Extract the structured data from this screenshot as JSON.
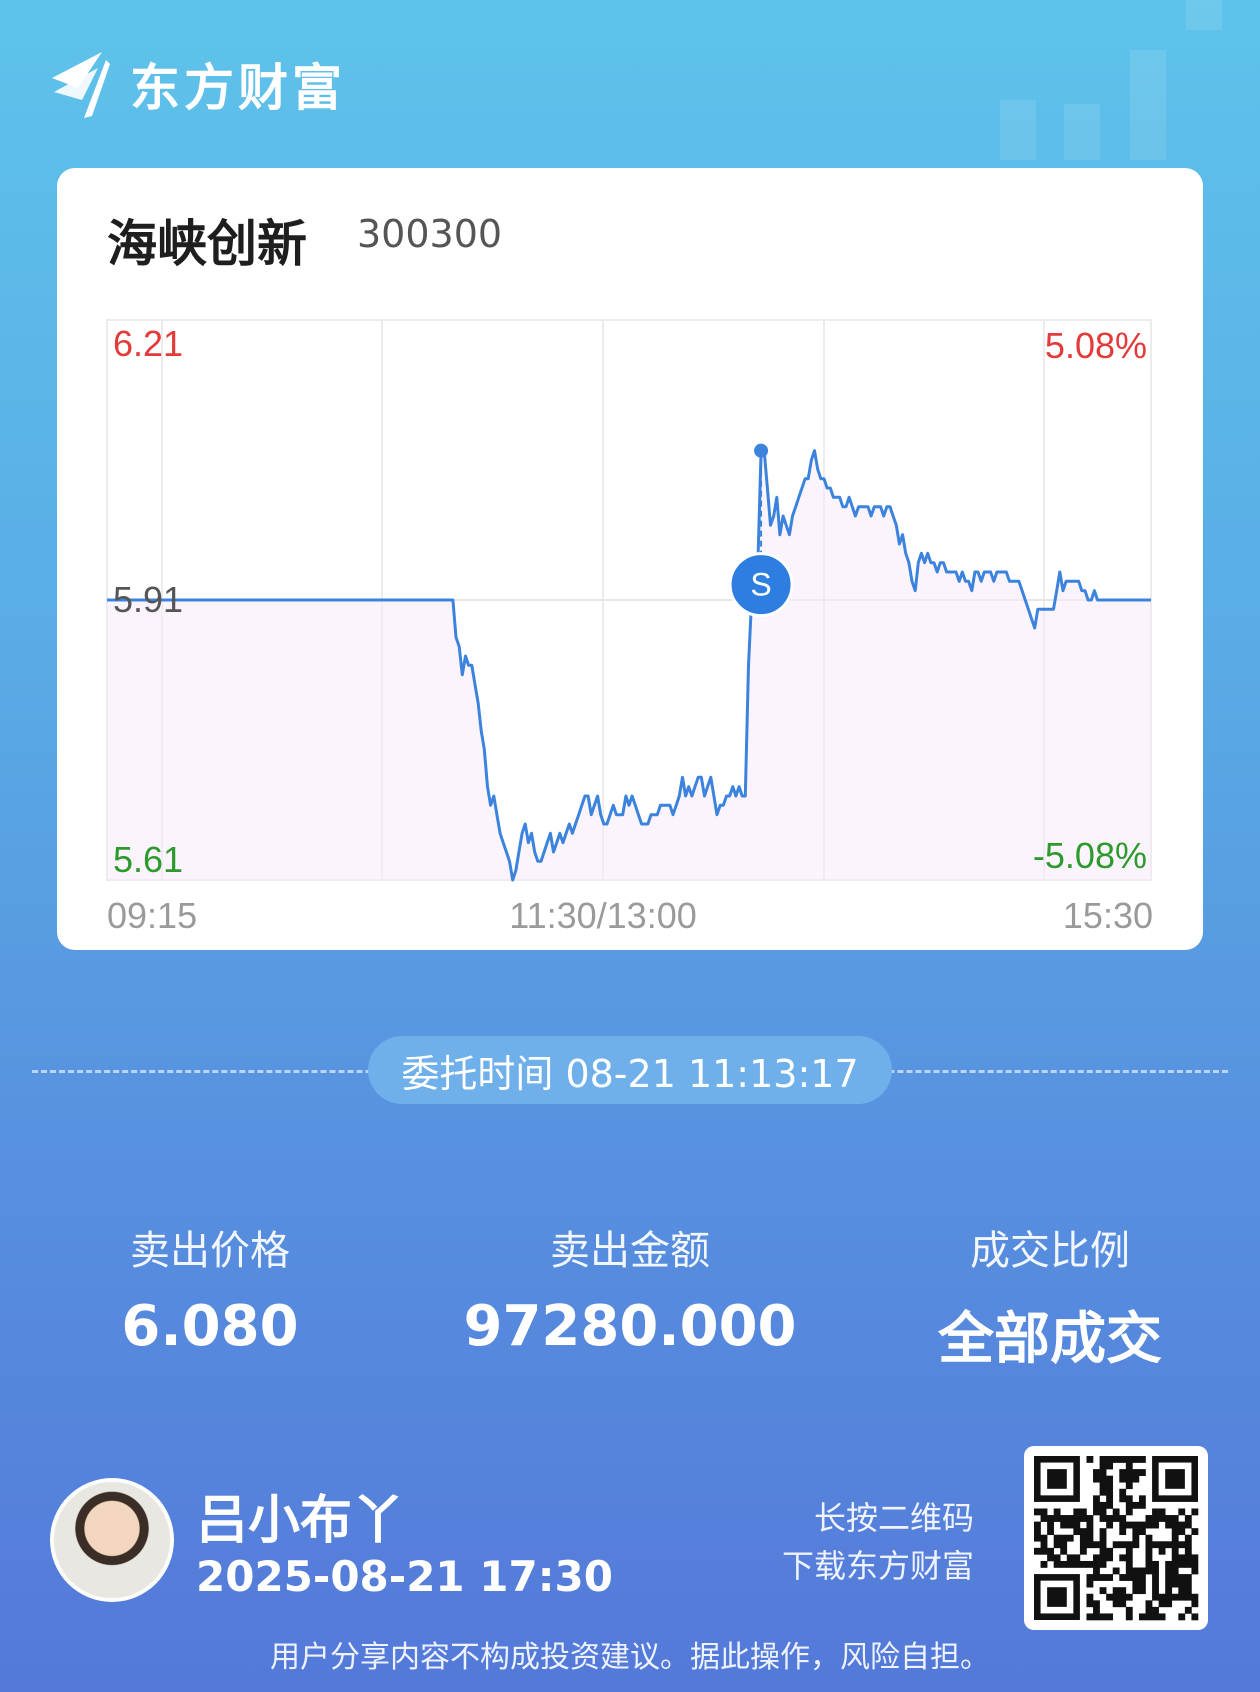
{
  "brand": {
    "name": "东方财富"
  },
  "stock": {
    "name": "海峡创新",
    "code": "300300"
  },
  "chart_data": {
    "type": "line",
    "price_axis": {
      "top": "6.21",
      "mid": "5.91",
      "bottom": "5.61"
    },
    "pct_axis": {
      "top": "5.08%",
      "bottom": "-5.08%"
    },
    "ylim": [
      5.61,
      6.21
    ],
    "x_ticks": [
      "09:15",
      "11:30/13:00",
      "15:30"
    ],
    "sell_marker": {
      "label": "S"
    },
    "series": [
      {
        "values": [
          5.91,
          5.91,
          5.91,
          5.91,
          5.91,
          5.91,
          5.91,
          5.91,
          5.91,
          5.91,
          5.91,
          5.91,
          5.91,
          5.91,
          5.91,
          5.91,
          5.91,
          5.91,
          5.91,
          5.91,
          5.91,
          5.91,
          5.91,
          5.91,
          5.91,
          5.91,
          5.91,
          5.91,
          5.91,
          5.91,
          5.91,
          5.91,
          5.91,
          5.91,
          5.91,
          5.91,
          5.91,
          5.91,
          5.91,
          5.91,
          5.91,
          5.91,
          5.91,
          5.91,
          5.91,
          5.91,
          5.91,
          5.91,
          5.91,
          5.91,
          5.91,
          5.91,
          5.91,
          5.91,
          5.91,
          5.91,
          5.91,
          5.91,
          5.91,
          5.91,
          5.91,
          5.91,
          5.91,
          5.91,
          5.91,
          5.91,
          5.91,
          5.91,
          5.91,
          5.91,
          5.91,
          5.91,
          5.91,
          5.91,
          5.91,
          5.91,
          5.91,
          5.91,
          5.91,
          5.91,
          5.91,
          5.91,
          5.91,
          5.91,
          5.91,
          5.91,
          5.91,
          5.91,
          5.91,
          5.91,
          5.91,
          5.91,
          5.91,
          5.91,
          5.91,
          5.91,
          5.91,
          5.91,
          5.91,
          5.91,
          5.91,
          5.91,
          5.91,
          5.91,
          5.91,
          5.91,
          5.91,
          5.91,
          5.91,
          5.91
        ]
      },
      {
        "values": [
          5.91,
          5.87,
          5.86,
          5.83,
          5.85,
          5.84,
          5.84,
          5.82,
          5.8,
          5.77,
          5.75,
          5.71,
          5.69,
          5.7,
          5.68,
          5.66,
          5.65,
          5.64,
          5.63,
          5.61,
          5.62,
          5.64,
          5.66,
          5.67,
          5.65,
          5.66,
          5.64,
          5.63,
          5.63,
          5.64,
          5.65,
          5.66,
          5.64,
          5.65,
          5.66,
          5.65,
          5.66,
          5.67,
          5.66,
          5.67,
          5.68,
          5.69,
          5.7,
          5.7,
          5.68,
          5.69,
          5.7,
          5.68,
          5.67,
          5.67,
          5.68,
          5.69,
          5.68,
          5.68,
          5.68,
          5.7,
          5.69,
          5.7,
          5.69,
          5.68,
          5.67,
          5.67,
          5.67,
          5.68,
          5.68,
          5.68,
          5.69,
          5.69,
          5.69,
          5.69,
          5.68,
          5.69,
          5.7,
          5.72,
          5.7,
          5.71,
          5.7,
          5.71,
          5.72,
          5.72,
          5.7,
          5.71,
          5.72,
          5.7,
          5.68,
          5.69,
          5.69,
          5.7,
          5.7,
          5.71,
          5.7,
          5.71,
          5.7,
          5.7,
          5.84,
          5.91,
          5.94,
          5.95,
          6.07,
          6.07,
          6.03,
          5.99,
          6.0,
          6.02,
          5.98,
          6.0,
          5.99,
          5.98,
          6.0,
          6.01,
          6.02,
          6.03,
          6.04
        ]
      },
      {
        "values": [
          6.04,
          6.06,
          6.07,
          6.05,
          6.04,
          6.04,
          6.03,
          6.03,
          6.02,
          6.02,
          6.02,
          6.01,
          6.01,
          6.02,
          6.01,
          6.0,
          6.01,
          6.01,
          6.01,
          6.01,
          6.0,
          6.01,
          6.01,
          6.01,
          6.0,
          6.01,
          6.01,
          6.0,
          5.99,
          5.97,
          5.98,
          5.96,
          5.95,
          5.93,
          5.92,
          5.95,
          5.96,
          5.95,
          5.96,
          5.95,
          5.95,
          5.94,
          5.95,
          5.95,
          5.94,
          5.94,
          5.94,
          5.94,
          5.93,
          5.94,
          5.93,
          5.93,
          5.92,
          5.94,
          5.94,
          5.93,
          5.94,
          5.94,
          5.94,
          5.93,
          5.94,
          5.94,
          5.94,
          5.94,
          5.93,
          5.93,
          5.93,
          5.93,
          5.92,
          5.91,
          5.9,
          5.89,
          5.88,
          5.9,
          5.9,
          5.9,
          5.9,
          5.9,
          5.9,
          5.92,
          5.94,
          5.92,
          5.93,
          5.93,
          5.93,
          5.93,
          5.93,
          5.92,
          5.92,
          5.91,
          5.91,
          5.92,
          5.91,
          5.91,
          5.91,
          5.91,
          5.91,
          5.91,
          5.91,
          5.91,
          5.91,
          5.91,
          5.91,
          5.91,
          5.91,
          5.91,
          5.91,
          5.91,
          5.91,
          5.91
        ]
      }
    ]
  },
  "entrust": {
    "label": "委托时间 08-21 11:13:17"
  },
  "stats": [
    {
      "label": "卖出价格",
      "value": "6.080"
    },
    {
      "label": "卖出金额",
      "value": "97280.000"
    },
    {
      "label": "成交比例",
      "value": "全部成交"
    }
  ],
  "user": {
    "name": "吕小布丫",
    "time": "2025-08-21 17:30"
  },
  "qr_hint": {
    "line1": "长按二维码",
    "line2": "下载东方财富"
  },
  "disclaimer": "用户分享内容不构成投资建议。据此操作，风险自担。",
  "colors": {
    "line": "#3b83dd",
    "up": "#e33a3a",
    "down": "#2c9a2c",
    "axis": "#9a9a9a"
  }
}
